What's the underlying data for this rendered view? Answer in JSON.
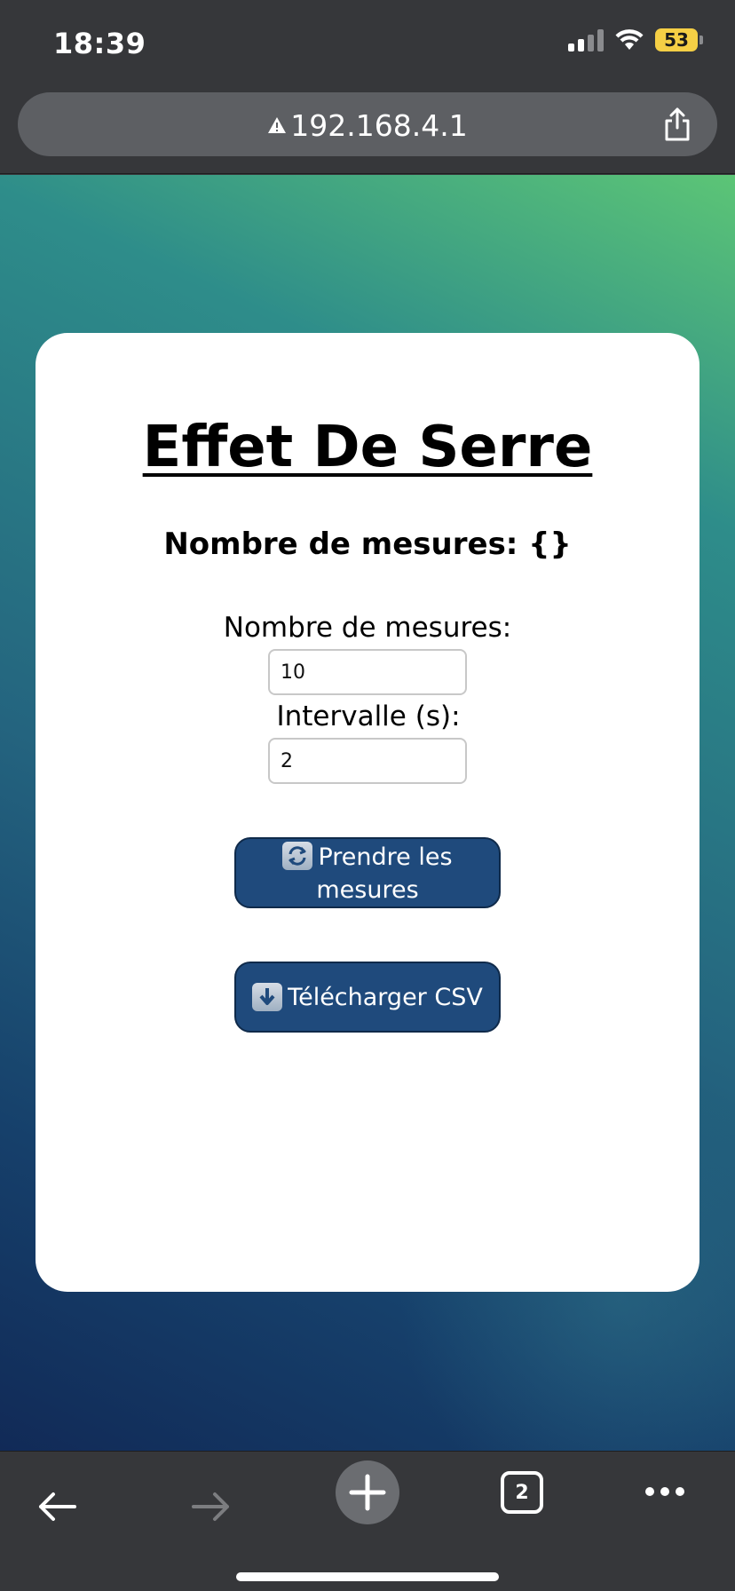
{
  "status_bar": {
    "time": "18:39",
    "battery_level": "53",
    "signal_bars_filled": 2,
    "signal_bars_total": 4
  },
  "browser": {
    "url": "192.168.4.1",
    "security_icon": "warning-triangle-icon",
    "open_tabs": "2"
  },
  "colors": {
    "button_bg": "#1f4a7c",
    "gradient_top": "#5cc576",
    "gradient_bottom": "#112a57",
    "battery": "#f5cf45"
  },
  "card": {
    "title": "Effet De Serre",
    "count_line": "Nombre de mesures: {}",
    "fields": {
      "count_label": "Nombre de mesures:",
      "count_value": "10",
      "interval_label": "Intervalle (s):",
      "interval_value": "2"
    },
    "buttons": {
      "measure_label": "Prendre les mesures",
      "measure_icon": "refresh-icon",
      "csv_label": "Télécharger CSV",
      "csv_icon": "download-arrow-icon"
    }
  }
}
